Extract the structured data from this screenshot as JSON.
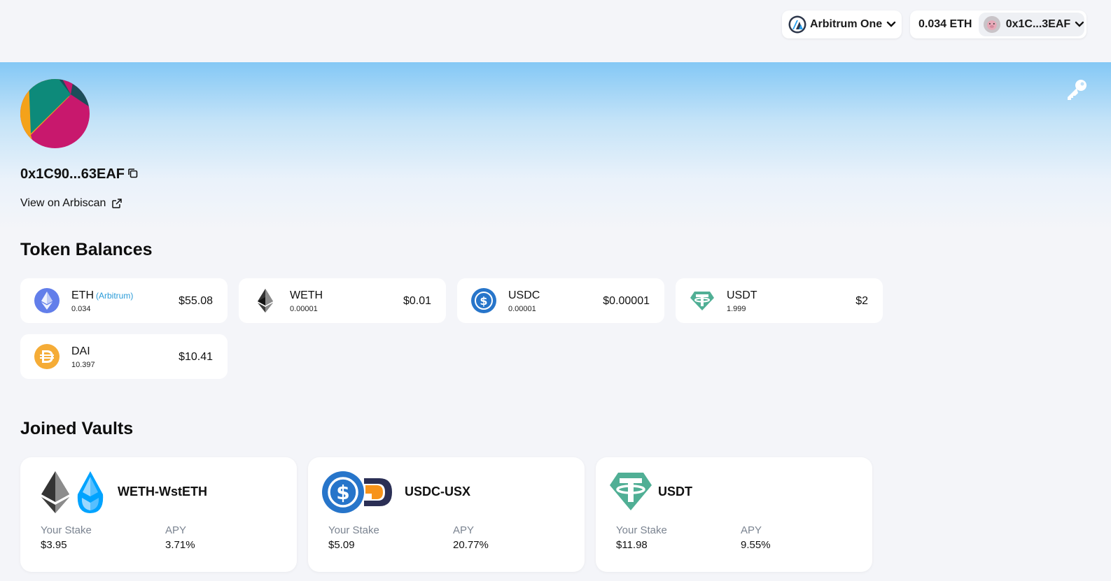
{
  "header": {
    "network_label": "Arbitrum One",
    "balance_label": "0.034 ETH",
    "account_label": "0x1C...3EAF"
  },
  "profile": {
    "address": "0x1C90...63EAF",
    "explorer_link": "View on Arbiscan"
  },
  "token_balances": {
    "title": "Token Balances",
    "tokens": [
      {
        "symbol": "ETH",
        "chain": "(Arbitrum)",
        "amount": "0.034",
        "usd": "$55.08",
        "icon": "eth-icon"
      },
      {
        "symbol": "WETH",
        "chain": "",
        "amount": "0.00001",
        "usd": "$0.01",
        "icon": "weth-icon"
      },
      {
        "symbol": "USDC",
        "chain": "",
        "amount": "0.00001",
        "usd": "$0.00001",
        "icon": "usdc-icon"
      },
      {
        "symbol": "USDT",
        "chain": "",
        "amount": "1.999",
        "usd": "$2",
        "icon": "usdt-icon"
      },
      {
        "symbol": "DAI",
        "chain": "",
        "amount": "10.397",
        "usd": "$10.41",
        "icon": "dai-icon"
      }
    ]
  },
  "joined_vaults": {
    "title": "Joined Vaults",
    "stake_label": "Your Stake",
    "apy_label": "APY",
    "vaults": [
      {
        "name": "WETH-WstETH",
        "stake": "$3.95",
        "apy": "3.71%"
      },
      {
        "name": "USDC-USX",
        "stake": "$5.09",
        "apy": "20.77%"
      },
      {
        "name": "USDT",
        "stake": "$11.98",
        "apy": "9.55%"
      }
    ]
  },
  "colors": {
    "eth": "#627eea",
    "usdc": "#2775ca",
    "usdt": "#50af95",
    "dai": "#f5ac37",
    "chain_link": "#2a9bd8",
    "muted": "#7b8491"
  }
}
